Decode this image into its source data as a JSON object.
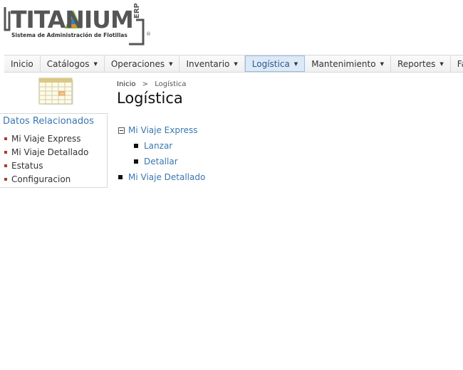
{
  "logo": {
    "word": "TITANIUM",
    "erp": "ERP",
    "subtitle": "Sistema de Administración de Flotillas",
    "registered": "®"
  },
  "nav": {
    "items": [
      {
        "label": "Inicio",
        "dropdown": false,
        "active": false
      },
      {
        "label": "Catálogos",
        "dropdown": true,
        "active": false
      },
      {
        "label": "Operaciones",
        "dropdown": true,
        "active": false
      },
      {
        "label": "Inventario",
        "dropdown": true,
        "active": false
      },
      {
        "label": "Logística",
        "dropdown": true,
        "active": true
      },
      {
        "label": "Mantenimiento",
        "dropdown": true,
        "active": false
      },
      {
        "label": "Reportes",
        "dropdown": true,
        "active": false
      },
      {
        "label": "Facturación",
        "dropdown": false,
        "active": false
      }
    ]
  },
  "sidebar": {
    "icon": "calendar-icon",
    "title": "Datos Relacionados",
    "items": [
      {
        "label": "Mi Viaje Express"
      },
      {
        "label": "Mi Viaje Detallado"
      },
      {
        "label": "Estatus"
      },
      {
        "label": "Configuracion"
      }
    ]
  },
  "breadcrumb": {
    "home": "Inicio",
    "separator": ">",
    "current": "Logística"
  },
  "main": {
    "title": "Logística",
    "tree": {
      "group1": {
        "label": "Mi Viaje Express",
        "expanded": true
      },
      "child1": {
        "label": "Lanzar"
      },
      "child2": {
        "label": "Detallar"
      },
      "group2": {
        "label": "Mi Viaje Detallado"
      }
    }
  },
  "colors": {
    "link": "#3a76b0",
    "active_tab_bg": "#dce9f7",
    "bullet": "#b03a2e",
    "logo_green": "#7ab648",
    "logo_blue": "#3a7fc1",
    "logo_orange": "#e8872d"
  }
}
